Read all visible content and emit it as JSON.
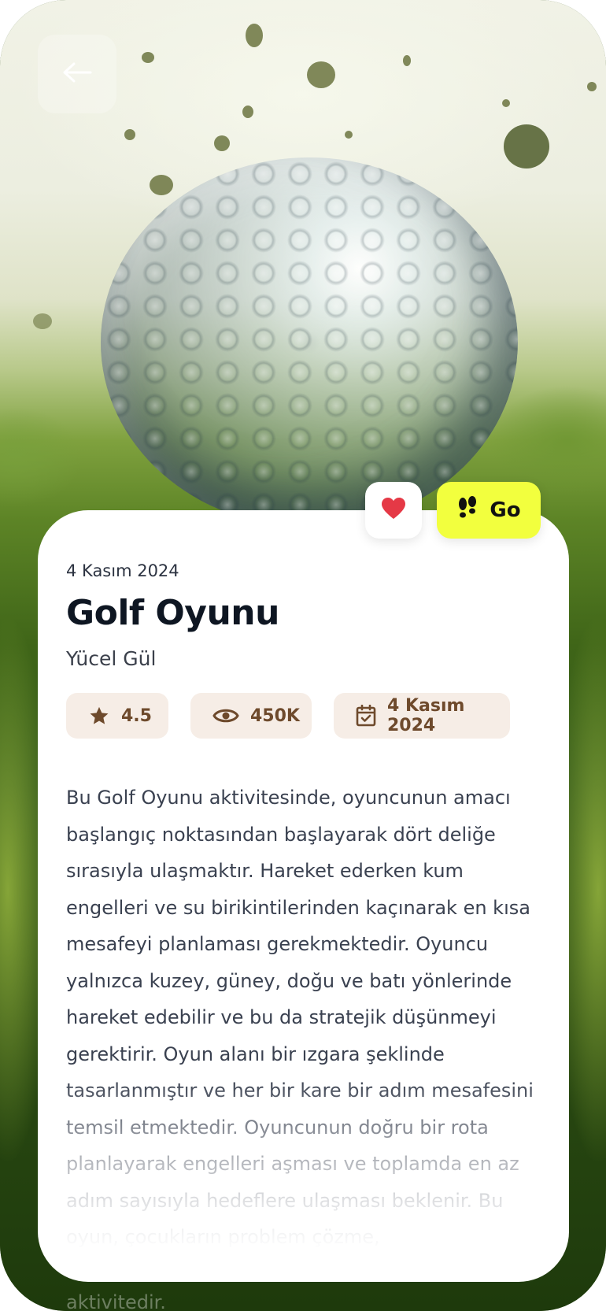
{
  "header": {
    "back_icon": "arrow-left-icon"
  },
  "actions": {
    "favorite_icon": "heart-icon",
    "favorite_color": "#e53946",
    "go_label": "Go",
    "go_icon": "footsteps-icon",
    "go_color": "#f2ff3e"
  },
  "activity": {
    "date": "4 Kasım 2024",
    "title": "Golf Oyunu",
    "author": "Yücel Gül",
    "stats": {
      "rating": "4.5",
      "rating_icon": "star-icon",
      "views": "450K",
      "views_icon": "eye-icon",
      "date": "4 Kasım 2024",
      "date_icon": "calendar-check-icon"
    },
    "description": "Bu Golf Oyunu aktivitesinde, oyuncunun amacı başlangıç noktasından başlayarak dört deliğe sırasıyla ulaşmaktır. Hareket ederken kum engelleri ve su birikintilerinden kaçınarak en kısa mesafeyi planlaması gerekmektedir. Oyuncu yalnızca kuzey, güney, doğu ve batı yönlerinde hareket edebilir ve bu da stratejik düşünmeyi gerektirir. Oyun alanı bir ızgara şeklinde tasarlanmıştır ve her bir kare bir adım mesafesini temsil etmektedir. Oyuncunun doğru bir rota planlayarak engelleri aşması ve toplamda en az adım sayısıyla hedeflere ulaşması beklenir. Bu oyun, çocukların problem çözme,",
    "overflow_text": "aktivitedir."
  },
  "colors": {
    "stat_bg": "#f6ede6",
    "stat_text": "#6e4a2c"
  }
}
